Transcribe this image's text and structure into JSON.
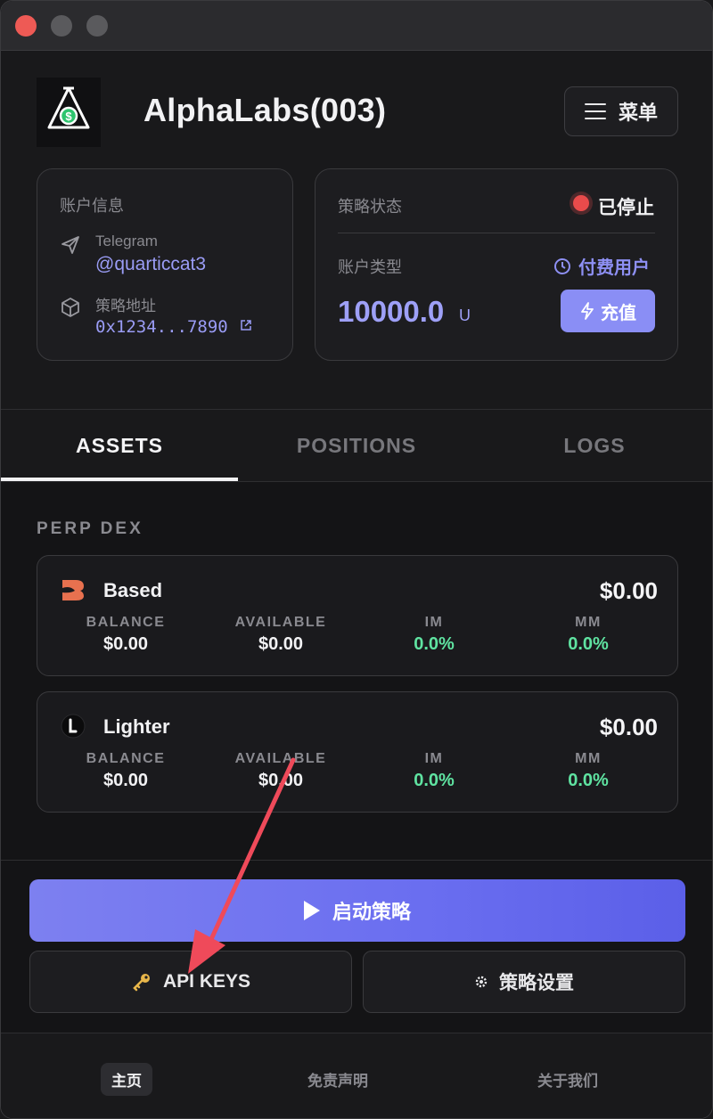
{
  "app": {
    "title": "AlphaLabs(003)",
    "menu_label": "菜单"
  },
  "account_card": {
    "title": "账户信息",
    "telegram_label": "Telegram",
    "telegram_handle": "@quarticcat3",
    "address_label": "策略地址",
    "address_value": "0x1234...7890"
  },
  "status_card": {
    "title": "策略状态",
    "status_text": "已停止",
    "status_color": "#e84b4b",
    "account_type_label": "账户类型",
    "account_type_value": "付费用户",
    "balance": "10000.0",
    "balance_unit": "U",
    "recharge_label": "充值"
  },
  "tabs": [
    {
      "label": "ASSETS",
      "active": true
    },
    {
      "label": "POSITIONS",
      "active": false
    },
    {
      "label": "LOGS",
      "active": false
    }
  ],
  "section": {
    "title": "PERP DEX"
  },
  "dex": [
    {
      "name": "Based",
      "total": "$0.00",
      "icon": "based-logo-icon",
      "columns": [
        {
          "header": "BALANCE",
          "value": "$0.00",
          "color": "white"
        },
        {
          "header": "AVAILABLE",
          "value": "$0.00",
          "color": "white"
        },
        {
          "header": "IM",
          "value": "0.0%",
          "color": "green"
        },
        {
          "header": "MM",
          "value": "0.0%",
          "color": "green"
        }
      ]
    },
    {
      "name": "Lighter",
      "total": "$0.00",
      "icon": "lighter-logo-icon",
      "columns": [
        {
          "header": "BALANCE",
          "value": "$0.00",
          "color": "white"
        },
        {
          "header": "AVAILABLE",
          "value": "$0.00",
          "color": "white"
        },
        {
          "header": "IM",
          "value": "0.0%",
          "color": "green"
        },
        {
          "header": "MM",
          "value": "0.0%",
          "color": "green"
        }
      ]
    }
  ],
  "actions": {
    "start_label": "启动策略",
    "api_keys_label": "API KEYS",
    "settings_label": "策略设置"
  },
  "footer": {
    "home": "主页",
    "disclaimer": "免责声明",
    "about": "关于我们"
  },
  "colors": {
    "accent": "#8a8ef5",
    "green": "#5fe3a1",
    "red_dot": "#e84b4b"
  }
}
